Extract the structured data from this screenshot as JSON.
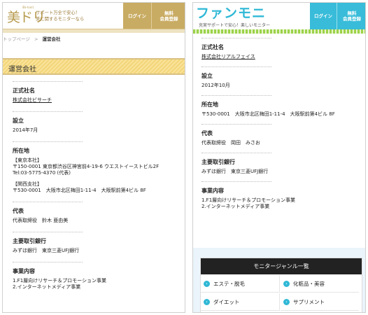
{
  "left": {
    "logo_ja": "美ドリ",
    "logo_small": "Bi-tori",
    "tagline": [
      "サポート万全で安心！",
      "美に関するモニターなら"
    ],
    "login": "ログイン",
    "register": [
      "無料",
      "会員登録"
    ],
    "breadcrumb": {
      "top": "トップページ",
      "sep": ">",
      "current": "運営会社"
    },
    "page_title": "運営会社",
    "sections": [
      {
        "label": "正式社名",
        "lines": [
          "株式会社ビサーチ"
        ],
        "link": true
      },
      {
        "label": "設立",
        "lines": [
          "2014年7月"
        ]
      },
      {
        "label": "所在地",
        "lines": [
          "【東京本社】",
          "〒150-0001 東京都渋谷区神宮前4-19-6 ウエストイーストビル2F",
          "Tel:03-5775-4370 (代表)",
          "",
          "【関西支社】",
          "〒530-0001　大阪市北区梅田1-11-4　大阪駅前第4ビル 8F"
        ]
      },
      {
        "label": "代表",
        "lines": [
          "代表取締役　鈴木 亜由美"
        ]
      },
      {
        "label": "主要取引銀行",
        "lines": [
          "みずほ銀行　東京三菱UFJ銀行"
        ]
      },
      {
        "label": "事業内容",
        "lines": [
          "1.F1層向けリサーチ＆プロモーション事業",
          "2.インターネットメディア事業"
        ]
      }
    ]
  },
  "right": {
    "logo": "ファンモニ",
    "tagline": "充実サポートで安心！楽しいモニター",
    "login": "ログイン",
    "register": [
      "無料",
      "会員登録"
    ],
    "sections": [
      {
        "label": "正式社名",
        "lines": [
          "株式会社リアルフェイス"
        ],
        "link": true
      },
      {
        "label": "設立",
        "lines": [
          "2012年10月"
        ]
      },
      {
        "label": "所在地",
        "lines": [
          "〒530-0001　大阪市北区梅田1-11-4　大阪駅前第4ビル 8F"
        ]
      },
      {
        "label": "代表",
        "lines": [
          "代表取締役　岡田　みさお"
        ]
      },
      {
        "label": "主要取引銀行",
        "lines": [
          "みずほ銀行　東京三菱UFJ銀行"
        ]
      },
      {
        "label": "事業内容",
        "lines": [
          "1.F1層向けリサーチ＆プロモーション事業",
          "2.インターネットメディア事業"
        ]
      }
    ],
    "genre": {
      "title": "モニタージャンル一覧",
      "items": [
        "エステ・脱毛",
        "化粧品・美容",
        "ダイエット",
        "サプリメント"
      ]
    }
  }
}
